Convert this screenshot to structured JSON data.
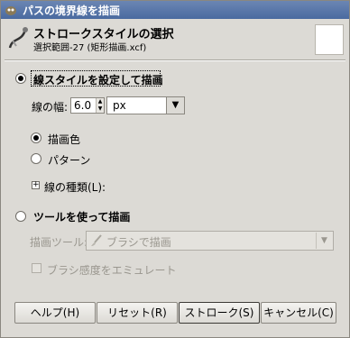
{
  "window": {
    "title": "パスの境界線を描画"
  },
  "header": {
    "title": "ストロークスタイルの選択",
    "subtitle": "選択範囲-27 (矩形描画.xcf)"
  },
  "stroke_line": {
    "label": "線スタイルを設定して描画",
    "selected": true,
    "width_label": "線の幅:",
    "width_value": "6.0",
    "unit_value": "px",
    "solid_label": "描画色",
    "pattern_label": "パターン",
    "solid_selected": true,
    "line_style_label": "線の種類(L):"
  },
  "stroke_tool": {
    "label": "ツールを使って描画",
    "selected": false,
    "tool_label": "描画ツール:",
    "tool_value": "ブラシで描画",
    "emulate_label": "ブラシ感度をエミュレート"
  },
  "buttons": {
    "help": "ヘルプ(H)",
    "reset": "リセット(R)",
    "stroke": "ストローク(S)",
    "cancel": "キャンセル(C)"
  }
}
